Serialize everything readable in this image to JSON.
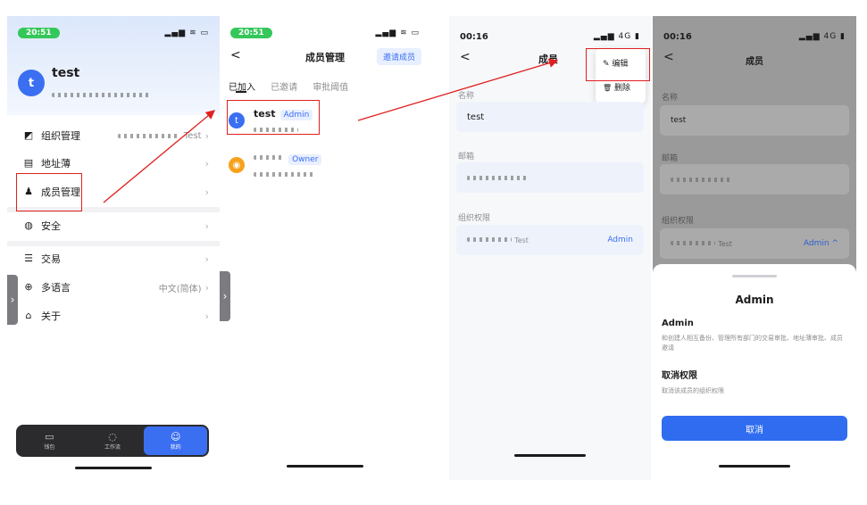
{
  "p1": {
    "time": "20:51",
    "signal": "▂▄▆ ≋ ▭",
    "avatar_letter": "t",
    "user_name": "test",
    "menu": [
      {
        "icon": "org-icon",
        "glyph": "◩",
        "label": "组织管理",
        "right": "Test",
        "blur": true
      },
      {
        "icon": "addressbook-icon",
        "glyph": "▤",
        "label": "地址薄",
        "right": ""
      },
      {
        "icon": "members-icon",
        "glyph": "♟",
        "label": "成员管理",
        "right": ""
      },
      {
        "icon": "security-icon",
        "glyph": "◍",
        "label": "安全",
        "right": ""
      },
      {
        "icon": "trade-icon",
        "glyph": "☰",
        "label": "交易",
        "right": ""
      },
      {
        "icon": "globe-icon",
        "glyph": "⊕",
        "label": "多语言",
        "right": "中文(简体)"
      },
      {
        "icon": "home-icon",
        "glyph": "⌂",
        "label": "关于",
        "right": ""
      }
    ],
    "nav": [
      {
        "icon": "wallet-icon",
        "glyph": "▭",
        "label": "钱包",
        "active": false
      },
      {
        "icon": "workflow-icon",
        "glyph": "◌",
        "label": "工作流",
        "active": false
      },
      {
        "icon": "mine-icon",
        "glyph": "☺",
        "label": "我的",
        "active": true
      }
    ]
  },
  "p2": {
    "time": "20:51",
    "signal": "▂▄▆ ≋ ▭",
    "back": "<",
    "title": "成员管理",
    "invite": "邀请成员",
    "tabs": [
      "已加入",
      "已邀请",
      "审批阈值"
    ],
    "members": [
      {
        "name": "test",
        "role": "Admin",
        "avatar_color": "#3a6ff2",
        "avatar_letter": "t"
      },
      {
        "name": "",
        "role": "Owner",
        "avatar_color": "#f6a21c",
        "avatar_letter": "◉"
      }
    ]
  },
  "p3": {
    "time": "00:16",
    "signal": "▂▄▆ 4G ▮",
    "back": "<",
    "title": "成员",
    "menu": [
      {
        "icon": "edit-icon",
        "glyph": "✎",
        "label": "编辑"
      },
      {
        "icon": "delete-icon",
        "glyph": "🗑",
        "label": "删除"
      }
    ],
    "name_label": "名称",
    "name_value": "test",
    "email_label": "邮箱",
    "perm_label": "组织权限",
    "perm_org": "Test",
    "perm_role": "Admin"
  },
  "p4": {
    "time": "00:16",
    "signal": "▂▄▆ 4G ▮",
    "back": "<",
    "title": "成员",
    "name_label": "名称",
    "name_value": "test",
    "email_label": "邮箱",
    "perm_label": "组织权限",
    "perm_org": "Test",
    "perm_role": "Admin ^",
    "sheet_title": "Admin",
    "opt1_title": "Admin",
    "opt1_desc": "和创建人相互备份、管理所有部门的交易审批、地址薄审批、成员邀请",
    "opt2_title": "取消权限",
    "opt2_desc": "取消该成员的组织权限",
    "cancel": "取消"
  }
}
